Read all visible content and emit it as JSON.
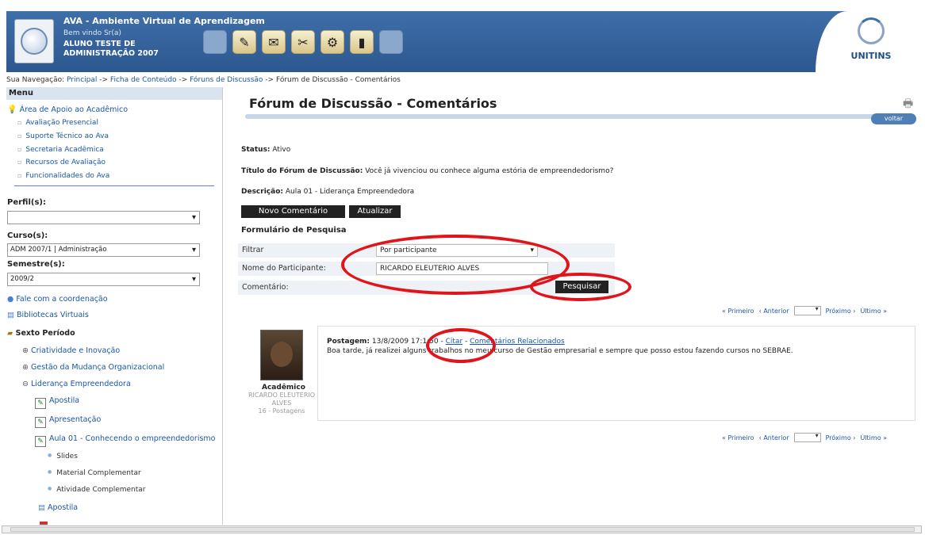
{
  "header": {
    "app_title": "AVA - Ambiente Virtual de Aprendizagem",
    "welcome": "Bem vindo Sr(a)",
    "user_name": "ALUNO TESTE DE ADMINISTRAÇÃO 2007",
    "right_logo": "UNITINS",
    "toolbar_icons": [
      "blank",
      "note-icon",
      "mail-icon",
      "tools-icon",
      "settings-icon",
      "book-icon",
      "blank"
    ]
  },
  "breadcrumb": {
    "prefix": "Sua Navegação:",
    "items": [
      "Principal",
      "Ficha de Conteúdo",
      "Fóruns de Discussão"
    ],
    "separator": "->",
    "current": "Fórum de Discussão - Comentários"
  },
  "sidebar": {
    "menu_title": "Menu",
    "support_area": "Área de Apoio ao Acadêmico",
    "support_items": [
      "Avaliação Presencial",
      "Suporte Técnico ao Ava",
      "Secretaria Acadêmica",
      "Recursos de Avaliação",
      "Funcionalidades do Ava"
    ],
    "perfil_label": "Perfil(s):",
    "perfil_value": "",
    "curso_label": "Curso(s):",
    "curso_value": "ADM 2007/1 | Administração",
    "semestre_label": "Semestre(s):",
    "semestre_value": "2009/2",
    "fale": "Fale com a coordenação",
    "bibliotecas": "Bibliotecas Virtuais",
    "periodo": "Sexto Período",
    "disciplinas": [
      "Criatividade e Inovação",
      "Gestão da Mudança Organizacional",
      "Liderança Empreendedora"
    ],
    "items": [
      "Apostila",
      "Apresentação",
      "Aula 01 - Conhecendo o empreendedorismo"
    ],
    "aula_items": [
      "Slides",
      "Material Complementar",
      "Atividade Complementar"
    ],
    "last_item": "Apostila"
  },
  "main": {
    "title": "Fórum de Discussão - Comentários",
    "voltar": "voltar",
    "status_label": "Status:",
    "status_value": "Ativo",
    "forum_title_label": "Título do Fórum de Discussão:",
    "forum_title_value": "Você já vivenciou ou conhece alguma estória de empreendedorismo?",
    "descricao_label": "Descrição:",
    "descricao_value": "Aula 01 - Liderança Empreendedora",
    "novo_comentario": "Novo Comentário",
    "atualizar": "Atualizar",
    "form_title": "Formulário de Pesquisa",
    "filtrar_label": "Filtrar",
    "filtrar_value": "Por participante",
    "nome_label": "Nome do Participante:",
    "nome_value": "RICARDO ELEUTERIO ALVES",
    "comentario_label": "Comentário:",
    "pesquisar": "Pesquisar",
    "pager": {
      "primeiro": "« Primeiro",
      "anterior": "‹ Anterior",
      "proximo": "Próximo ›",
      "ultimo": "Último »"
    }
  },
  "post": {
    "role": "Acadêmico",
    "author": "RICARDO ELEUTERIO ALVES",
    "count": "16 - Postagens",
    "label": "Postagem:",
    "datetime": "13/8/2009 17:1:50",
    "citar": "Citar",
    "relacionados": "Comentários Relacionados",
    "text": "Boa tarde, já realizei alguns trabalhos no meu curso de Gestão empresarial e sempre que posso estou fazendo cursos no SEBRAE."
  },
  "colors": {
    "header_blue": "#3f6ea8",
    "link_blue": "#1a56a8",
    "highlight_red": "#e0141a"
  }
}
